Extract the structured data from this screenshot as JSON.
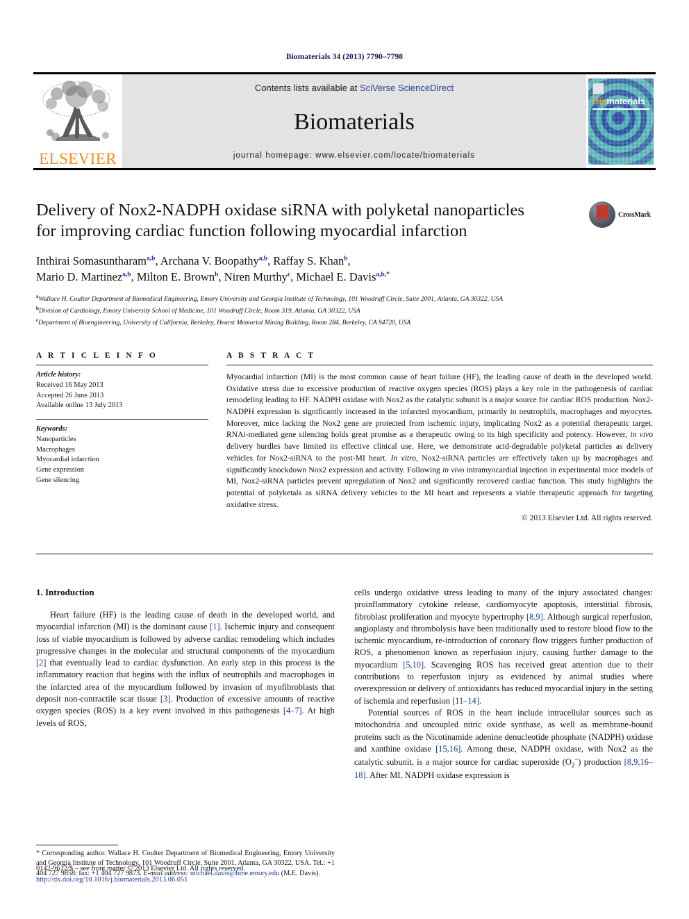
{
  "running_head": "Biomaterials 34 (2013) 7790–7798",
  "masthead": {
    "publisher_name": "ELSEVIER",
    "contents_prefix": "Contents lists available at ",
    "contents_link": "SciVerse ScienceDirect",
    "journal_name": "Biomaterials",
    "homepage": "journal homepage: www.elsevier.com/locate/biomaterials",
    "cover": {
      "title_first": "Bio",
      "title_second": "materials",
      "footer_line": "ELSEVIER"
    }
  },
  "article": {
    "title_line1": "Delivery of Nox2-NADPH oxidase siRNA with polyketal nanoparticles",
    "title_line2": "for improving cardiac function following myocardial infarction",
    "crossmark_label": "CrossMark",
    "authors": [
      {
        "name": "Inthirai Somasuntharam",
        "sup": "a,b",
        "sep": ", "
      },
      {
        "name": "Archana V. Boopathy",
        "sup": "a,b",
        "sep": ", "
      },
      {
        "name": "Raffay S. Khan",
        "sup": "b",
        "sep": ","
      },
      {
        "name": "Mario D. Martinez",
        "sup": "a,b",
        "sep": ", "
      },
      {
        "name": "Milton E. Brown",
        "sup": "b",
        "sep": ", "
      },
      {
        "name": "Niren Murthy",
        "sup": "c",
        "sep": ", "
      },
      {
        "name": "Michael E. Davis",
        "sup": "a,b,*",
        "sep": ""
      }
    ],
    "affiliations": [
      {
        "marker": "a",
        "text": "Wallace H. Coulter Department of Biomedical Engineering, Emory University and Georgia Institute of Technology, 101 Woodruff Circle, Suite 2001, Atlanta, GA 30322, USA"
      },
      {
        "marker": "b",
        "text": "Division of Cardiology, Emory University School of Medicine, 101 Woodruff Circle, Room 319, Atlanta, GA 30322, USA"
      },
      {
        "marker": "c",
        "text": "Department of Bioengineering, University of California, Berkeley, Hearst Memorial Mining Building, Room 284, Berkeley, CA 94720, USA"
      }
    ]
  },
  "article_info": {
    "heading": "A R T I C L E  I N F O",
    "history_label": "Article history:",
    "history": [
      "Received 16 May 2013",
      "Accepted 26 June 2013",
      "Available online 13 July 2013"
    ],
    "keywords_label": "Keywords:",
    "keywords": [
      "Nanoparticles",
      "Macrophages",
      "Myocardial infarction",
      "Gene expression",
      "Gene silencing"
    ]
  },
  "abstract": {
    "heading": "A B S T R A C T",
    "part1": "Myocardial infarction (MI) is the most common cause of heart failure (HF), the leading cause of death in the developed world. Oxidative stress due to excessive production of reactive oxygen species (ROS) plays a key role in the pathogenesis of cardiac remodeling leading to HF. NADPH oxidase with Nox2 as the catalytic subunit is a major source for cardiac ROS production. Nox2-NADPH expression is significantly increased in the infarcted myocardium, primarily in neutrophils, macrophages and myocytes. Moreover, mice lacking the Nox2 gene are protected from ischemic injury, implicating Nox2 as a potential therapeutic target. RNAi-mediated gene silencing holds great promise as a therapeutic owing to its high specificity and potency. However, ",
    "italic1": "in vivo",
    "part2": " delivery hurdles have limited its effective clinical use. Here, we demonstrate acid-degradable polyketal particles as delivery vehicles for Nox2-siRNA to the post-MI heart. ",
    "italic2": "In vitro",
    "part3": ", Nox2-siRNA particles are effectively taken up by macrophages and significantly knockdown Nox2 expression and activity. Following ",
    "italic3": "in vivo",
    "part4": " intramyocardial injection in experimental mice models of MI, Nox2-siRNA particles prevent upregulation of Nox2 and significantly recovered cardiac function. This study highlights the potential of polyketals as siRNA delivery vehicles to the MI heart and represents a viable therapeutic approach for targeting oxidative stress.",
    "copyright": "© 2013 Elsevier Ltd. All rights reserved."
  },
  "body": {
    "section_heading": "1. Introduction",
    "left_paragraph": {
      "t0": "Heart failure (HF) is the leading cause of death in the developed world, and myocardial infarction (MI) is the dominant cause ",
      "c1": "[1]",
      "t1": ". Ischemic injury and consequent loss of viable myocardium is followed by adverse cardiac remodeling which includes progressive changes in the molecular and structural components of the myocardium ",
      "c2": "[2]",
      "t2": " that eventually lead to cardiac dysfunction. An early step in this process is the inflammatory reaction that begins with the influx of neutrophils and macrophages in the infarcted area of the myocardium followed by invasion of myofibroblasts that deposit non-contractile scar tissue ",
      "c3": "[3]",
      "t3": ". Production of excessive amounts of reactive oxygen species (ROS) is a key event involved in this pathogenesis ",
      "c4": "[4–7]",
      "t4": ". At high levels of ROS,"
    },
    "right_paragraph_1": {
      "t0": "cells undergo oxidative stress leading to many of the injury associated changes: proinflammatory cytokine release, cardiomyocyte apoptosis, interstitial fibrosis, fibroblast proliferation and myocyte hypertrophy ",
      "c1": "[8,9]",
      "t1": ". Although surgical reperfusion, angioplasty and thrombolysis have been traditionally used to restore blood flow to the ischemic myocardium, re-introduction of coronary flow triggers further production of ROS, a phenomenon known as reperfusion injury, causing further damage to the myocardium ",
      "c2": "[5,10]",
      "t2": ". Scavenging ROS has received great attention due to their contributions to reperfusion injury as evidenced by animal studies where overexpression or delivery of antioxidants has reduced myocardial injury in the setting of ischemia and reperfusion ",
      "c3": "[11–14]",
      "t3": "."
    },
    "right_paragraph_2": {
      "t0": "Potential sources of ROS in the heart include intracellular sources such as mitochondria and uncoupled nitric oxide synthase, as well as membrane-bound proteins such as the Nicotinamide adenine denucleotide phosphate (NADPH) oxidase and xanthine oxidase ",
      "c1": "[15,16]",
      "t1": ". Among these, NADPH oxidase, with Nox2 as the catalytic subunit, is a major source for cardiac superoxide (O",
      "sub": "2",
      "sup": "−",
      "t2": ") production ",
      "c2": "[8,9,16–18]",
      "t3": ". After MI, NADPH oxidase expression is"
    }
  },
  "footnote": {
    "star": "*",
    "text": " Corresponding author. Wallace H. Coulter Department of Biomedical Engineering, Emory University and Georgia Institute of Technology, 101 Woodruff Circle, Suite 2001, Atlanta, GA 30322, USA. Tel.: +1 404 727 9858; fax: +1 404 727 9873.",
    "email_label": "E-mail address:",
    "email": "michael.davis@bme.emory.edu",
    "email_suffix": " (M.E. Davis)."
  },
  "bottom_matter": {
    "issn_line": "0142-9612/$ – see front matter © 2013 Elsevier Ltd. All rights reserved.",
    "doi": "http://dx.doi.org/10.1016/j.biomaterials.2013.06.051"
  },
  "colors": {
    "elsevier_orange": "#f68b1f",
    "link_blue": "#1d3a8f",
    "running_head_navy": "#12175c",
    "masthead_grey": "#e3e3e3",
    "cover_teal": "#4fb3b8",
    "crossmark_red": "#c0392b"
  }
}
